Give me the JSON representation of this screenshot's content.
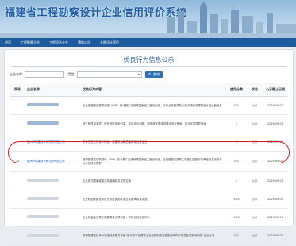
{
  "header": {
    "site_title": "福建省工程勘察设计企业信用评价系统"
  },
  "nav": {
    "items": [
      "首页",
      "工程勘察企业",
      "工程设计企业",
      "通知公告",
      "长期设计项目"
    ]
  },
  "page": {
    "title": "优良行为信息公示"
  },
  "filters": {
    "company_label": "企业名称:",
    "type_label": "类型:",
    "type_value": "",
    "search_label": "查询"
  },
  "table": {
    "headers": [
      "序号",
      "企业名称",
      "优良行为内容",
      "信用分数",
      "状态",
      "公示截止日期"
    ],
    "rows": [
      {
        "no": "",
        "name": "",
        "content": "企业在福建省建筑领域（BIM）技术推广应用获国家级工程设计奖，对行业转型具有示范引领作用建筑设计奖优良信息",
        "score": "0.5",
        "status": "公示",
        "date": "2025-09-01"
      },
      {
        "no": "",
        "name": "",
        "content": "获工程质量奖项，但在良好信用记录，实现设计创新，转型获优秀成绩建设设计等级，作业区域表彰等级",
        "score": "1",
        "status": "公示",
        "date": "2025-09-01"
      },
      {
        "no": "",
        "name": "福州市城建设计研究院有限公司",
        "content": "获评先进工程设计项目，在建设创新质量获评优秀企业",
        "score": "1",
        "status": "公示",
        "date": "2025-09-01"
      },
      {
        "no": "13",
        "name": "福州市城建设计研究院有限公司",
        "content": "取得福建省建筑领域（BIM）技术推广应用获得国家级工程设计奖，且被福建省建筑工程施工图数字化审查信息系统评为示范项目表彰",
        "score": "0.5",
        "status": "公示",
        "date": "2025-09-01"
      },
      {
        "no": "",
        "name": "",
        "content": "企业参与国家级重点标准编制并发布实施",
        "score": "1",
        "status": "公示",
        "date": "2025-09-01"
      },
      {
        "no": "",
        "name": "",
        "content": "企业获国家级优秀设计项目奖励并通过年度审核及评选",
        "score": "0.25",
        "status": "公示",
        "date": "2025-09-01"
      },
      {
        "no": "",
        "name": "",
        "content": "企业获省级优秀工程勘察设计项目奖，获得优良信用评价",
        "score": "0.25",
        "status": "公示",
        "date": "2025-09-01"
      },
      {
        "no": "",
        "name": "",
        "content": "取得福建省技术标准编制资格并参编“基于数字化建筑工业化预制的高性能结构构件质量检测技术规范”企业标准",
        "score": "0.5",
        "status": "公示",
        "date": "2025-09-01"
      }
    ]
  }
}
